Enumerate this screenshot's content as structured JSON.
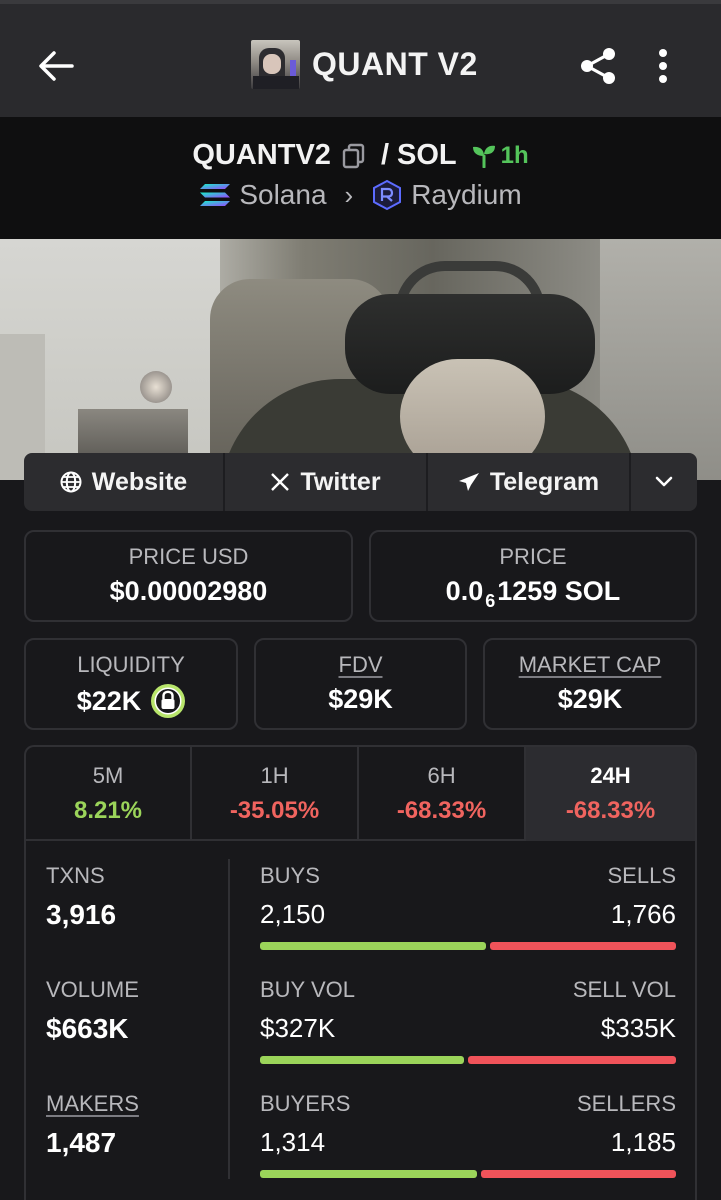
{
  "header": {
    "title": "QUANT V2",
    "back_icon": "arrow-left-icon",
    "share_icon": "share-icon",
    "more_icon": "more-vertical-icon"
  },
  "pair": {
    "base": "QUANTV2",
    "separator": "/",
    "quote": "SOL",
    "age": "1h",
    "chain": "Solana",
    "dex": "Raydium"
  },
  "links": {
    "website": "Website",
    "twitter": "Twitter",
    "telegram": "Telegram"
  },
  "cards": {
    "price_usd_label": "PRICE USD",
    "price_usd_value": "$0.00002980",
    "price_label": "PRICE",
    "price_prefix": "0.0",
    "price_subscript": "6",
    "price_suffix": "1259 SOL",
    "liquidity_label": "LIQUIDITY",
    "liquidity_value": "$22K",
    "fdv_label": "FDV",
    "fdv_value": "$29K",
    "mcap_label": "MARKET CAP",
    "mcap_value": "$29K"
  },
  "timeframes": [
    {
      "label": "5M",
      "change": "8.21%",
      "trend": "up"
    },
    {
      "label": "1H",
      "change": "-35.05%",
      "trend": "down"
    },
    {
      "label": "6H",
      "change": "-68.33%",
      "trend": "down"
    },
    {
      "label": "24H",
      "change": "-68.33%",
      "trend": "down",
      "active": true
    }
  ],
  "stats": {
    "txns_label": "TXNS",
    "txns_value": "3,916",
    "volume_label": "VOLUME",
    "volume_value": "$663K",
    "makers_label": "MAKERS",
    "makers_value": "1,487",
    "buys_label": "BUYS",
    "buys_value": "2,150",
    "sells_label": "SELLS",
    "sells_value": "1,766",
    "buys_share": 0.549,
    "buy_vol_label": "BUY VOL",
    "buy_vol_value": "$327K",
    "sell_vol_label": "SELL VOL",
    "sell_vol_value": "$335K",
    "buy_vol_share": 0.494,
    "buyers_label": "BUYERS",
    "buyers_value": "1,314",
    "sellers_label": "SELLERS",
    "sellers_value": "1,185",
    "buyers_share": 0.526
  },
  "colors": {
    "up": "#9bd45a",
    "down": "#f0645f",
    "age": "#54c45b"
  }
}
